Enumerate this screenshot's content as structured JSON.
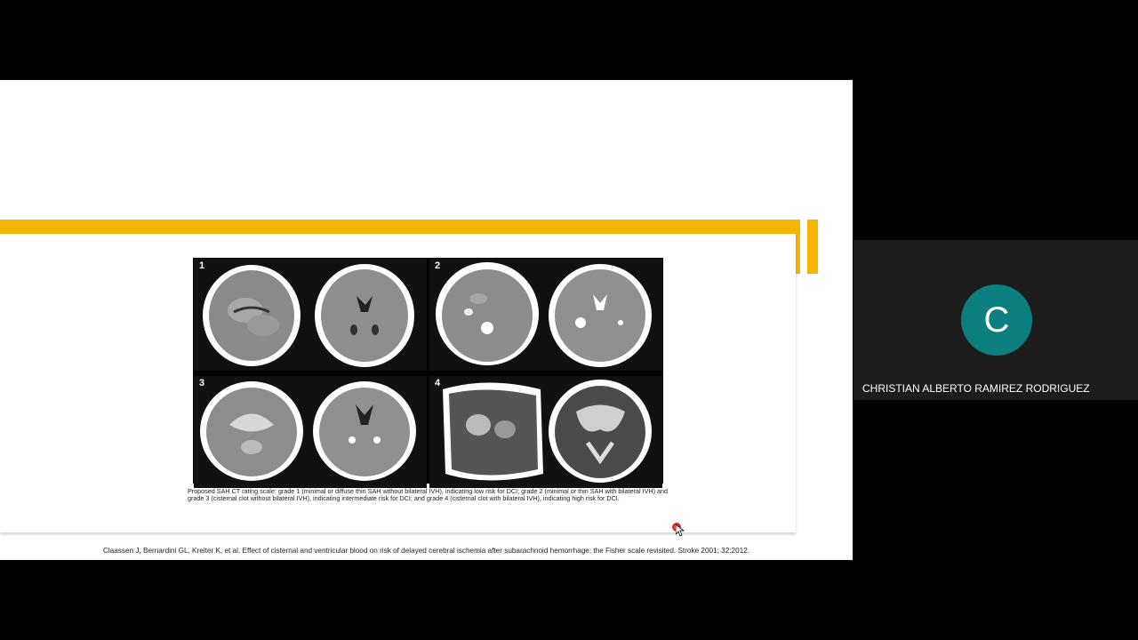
{
  "figure": {
    "panels": [
      {
        "number": "1"
      },
      {
        "number": "2"
      },
      {
        "number": "3"
      },
      {
        "number": "4"
      }
    ],
    "caption": "Proposed SAH CT rating scale: grade 1 (minimal or diffuse thin SAH without bilateral IVH), indicating low risk for DCI; grade 2 (minimal or thin SAH with bilateral IVH) and grade 3 (cisternal clot without bilateral IVH), indicating intermediate risk for DCI; and grade 4 (cisternal clot with bilateral IVH), indicating high risk for DCI."
  },
  "citation": "Claassen J, Bernardini GL, Kreiter K, et al. Effect of cisternal and ventricular blood on risk of delayed cerebral ischemia after subarachnoid hemorrhage: the Fisher scale revisited. Stroke 2001; 32:2012.",
  "participant": {
    "initial": "C",
    "name": "CHRISTIAN ALBERTO RAMIREZ RODRIGUEZ",
    "avatar_color": "#0b7f7f"
  },
  "colors": {
    "accent_bar": "#f7b500",
    "laser": "#e01010"
  }
}
